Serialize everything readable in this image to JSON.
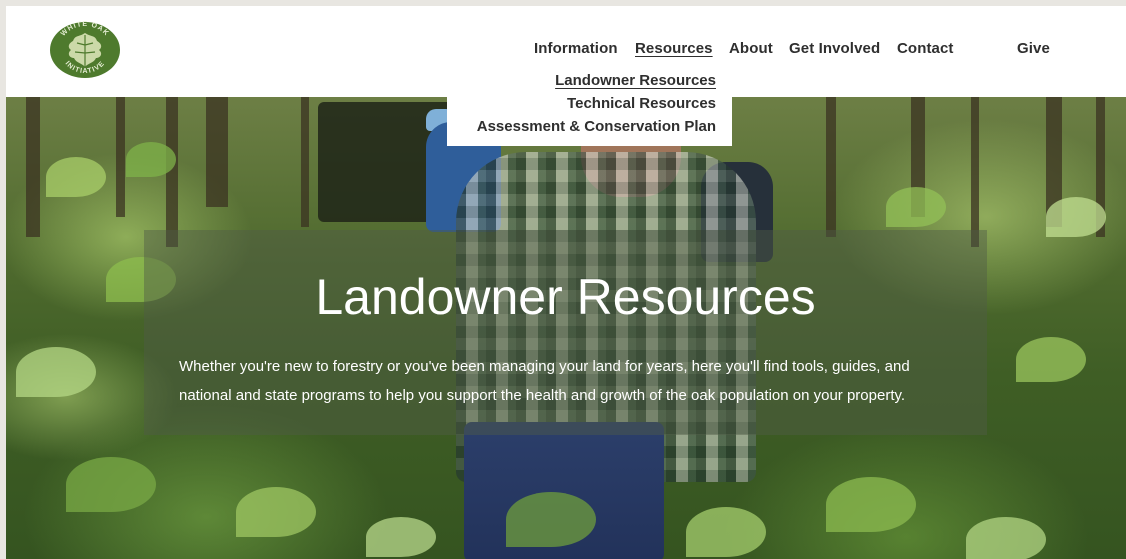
{
  "logo": {
    "text": "WHITE OAK INITIATIVE",
    "icon": "oak-leaf-icon",
    "color": "#4e7a2d"
  },
  "nav": {
    "items": [
      {
        "label": "Information"
      },
      {
        "label": "Resources",
        "active": true
      },
      {
        "label": "About"
      },
      {
        "label": "Get Involved"
      },
      {
        "label": "Contact"
      },
      {
        "label": "Give"
      }
    ]
  },
  "dropdown": {
    "items": [
      {
        "label": "Landowner Resources",
        "active": true
      },
      {
        "label": "Technical Resources"
      },
      {
        "label": "Assessment & Conservation Plan"
      }
    ]
  },
  "hero": {
    "title": "Landowner Resources",
    "description": "Whether you're new to forestry or you've been managing your land for years, here you'll find tools, guides, and national and state programs to help you support the health and growth of the oak population on your property."
  }
}
